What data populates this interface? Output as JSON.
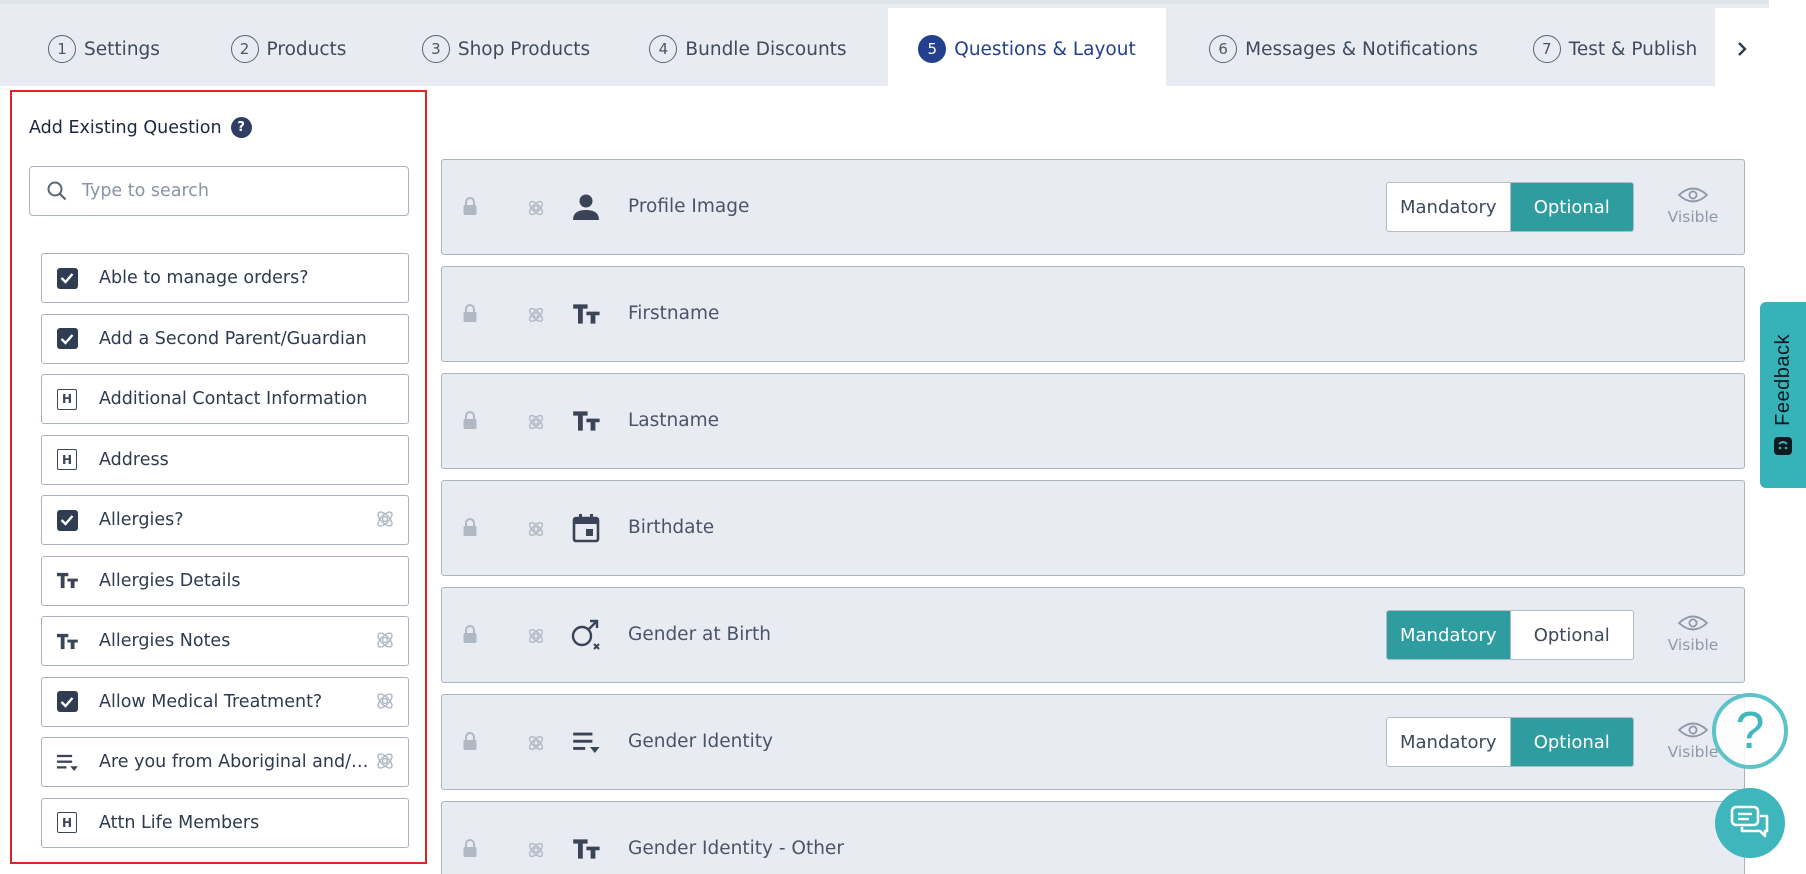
{
  "tabs": [
    {
      "num": "1",
      "label": "Settings"
    },
    {
      "num": "2",
      "label": "Products"
    },
    {
      "num": "3",
      "label": "Shop Products"
    },
    {
      "num": "4",
      "label": "Bundle Discounts"
    },
    {
      "num": "5",
      "label": "Questions & Layout"
    },
    {
      "num": "6",
      "label": "Messages & Notifications"
    },
    {
      "num": "7",
      "label": "Test & Publish"
    }
  ],
  "active_tab": "Questions & Layout",
  "left": {
    "title": "Add Existing Question",
    "help": "?",
    "search_placeholder": "Type to search",
    "items": [
      {
        "label": "Able to manage orders?",
        "icon": "checkbox-checked-icon",
        "atom": false
      },
      {
        "label": "Add a Second Parent/Guardian",
        "icon": "checkbox-checked-icon",
        "atom": false
      },
      {
        "label": "Additional Contact Information",
        "icon": "heading-icon",
        "atom": false
      },
      {
        "label": "Address",
        "icon": "heading-icon",
        "atom": false
      },
      {
        "label": "Allergies?",
        "icon": "checkbox-checked-icon",
        "atom": true
      },
      {
        "label": "Allergies Details",
        "icon": "text-icon",
        "atom": false
      },
      {
        "label": "Allergies Notes",
        "icon": "text-icon",
        "atom": true
      },
      {
        "label": "Allow Medical Treatment?",
        "icon": "checkbox-checked-icon",
        "atom": true
      },
      {
        "label": "Are you from Aboriginal and/or Torres Strait Islander descent?",
        "icon": "dropdown-list-icon",
        "atom": true
      },
      {
        "label": "Attn Life Members",
        "icon": "heading-icon",
        "atom": false
      }
    ],
    "heading_glyph": "H"
  },
  "rows": [
    {
      "label": "Profile Image",
      "icon": "person-icon",
      "mandatory_label": "Mandatory",
      "optional_label": "Optional",
      "selected": "Optional",
      "visible_label": "Visible",
      "has_controls": true
    },
    {
      "label": "Firstname",
      "icon": "text-icon",
      "has_controls": false
    },
    {
      "label": "Lastname",
      "icon": "text-icon",
      "has_controls": false
    },
    {
      "label": "Birthdate",
      "icon": "calendar-icon",
      "has_controls": false
    },
    {
      "label": "Gender at Birth",
      "icon": "gender-icon",
      "mandatory_label": "Mandatory",
      "optional_label": "Optional",
      "selected": "Mandatory",
      "visible_label": "Visible",
      "has_controls": true
    },
    {
      "label": "Gender Identity",
      "icon": "dropdown-list-icon",
      "mandatory_label": "Mandatory",
      "optional_label": "Optional",
      "selected": "Optional",
      "visible_label": "Visible",
      "has_controls": true
    },
    {
      "label": "Gender Identity - Other",
      "icon": "text-icon",
      "has_controls": false
    }
  ],
  "feedback_label": "Feedback",
  "help_glyph": "?",
  "colors": {
    "accent_teal": "#2f9da0",
    "active_tab": "#23408e",
    "panel_highlight": "#e02424",
    "feedback": "#36b2b9"
  }
}
